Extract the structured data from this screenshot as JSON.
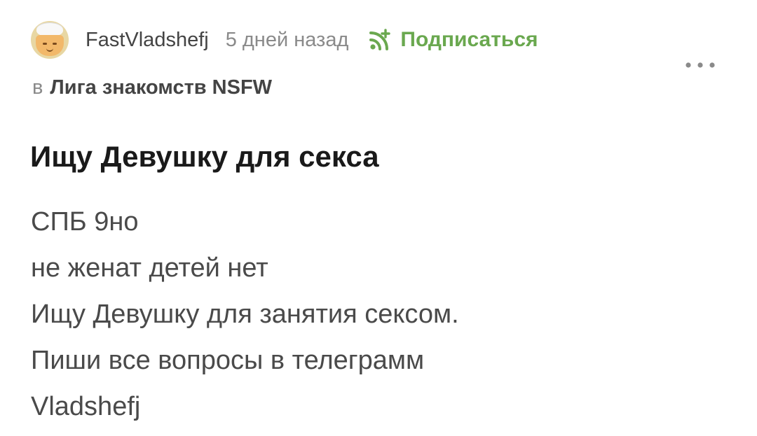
{
  "post": {
    "author": {
      "name": "FastVladshefj",
      "avatar_icon": "chef-avatar-icon"
    },
    "time": "5 дней назад",
    "subscribe": {
      "label": "Подписаться",
      "icon": "rss-subscribe-icon",
      "color": "#6aa84f"
    },
    "more_icon": "more-dots-icon",
    "community": {
      "prefix": "в",
      "name": "Лига знакомств NSFW"
    },
    "title": "Ищу Девушку для секса",
    "body_lines": [
      "СПБ 9но",
      "не женат детей нет",
      "Ищу Девушку для занятия сексом.",
      "Пиши все вопросы в телеграмм",
      "Vladshefj"
    ]
  }
}
